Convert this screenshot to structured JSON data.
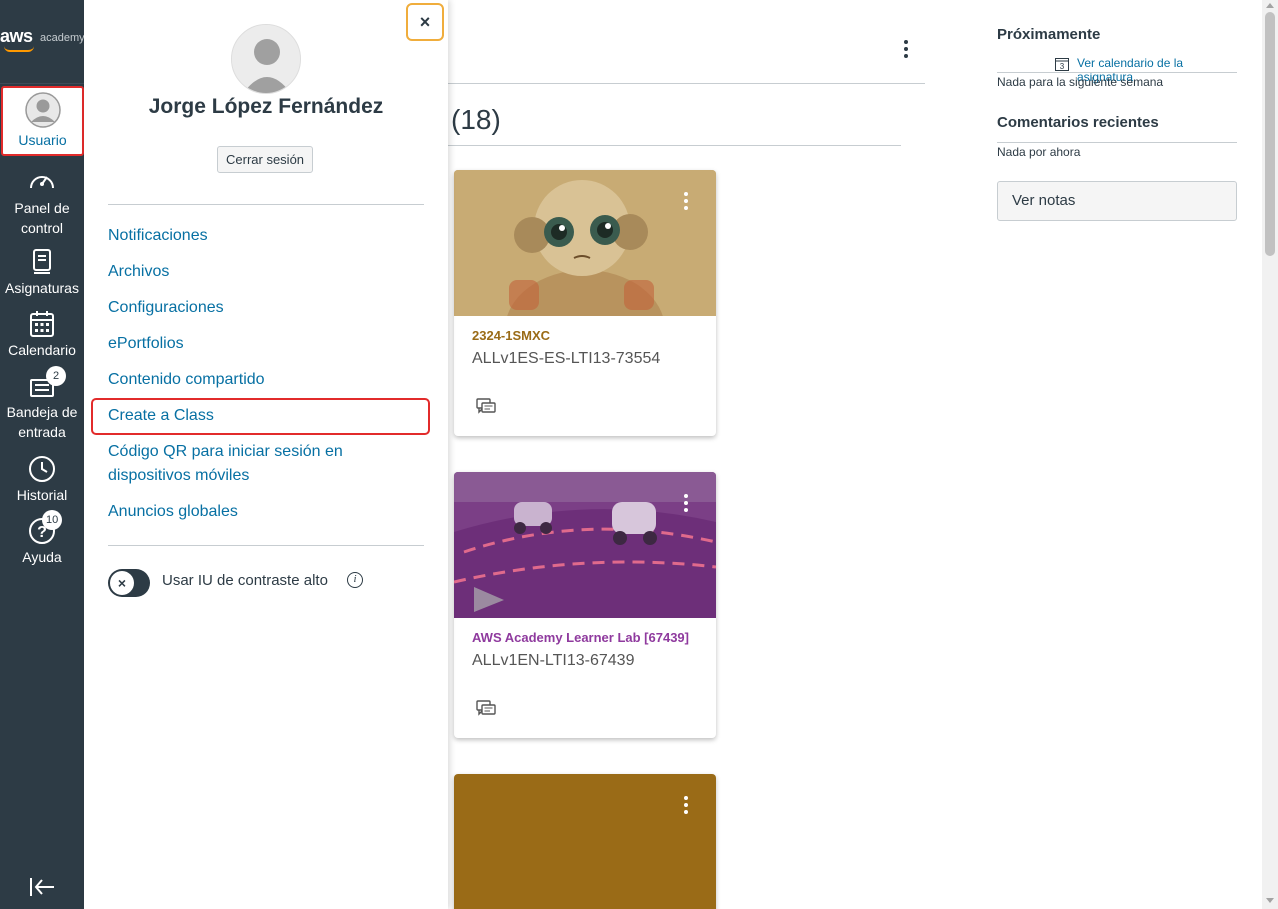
{
  "brand": {
    "aws": "aws",
    "academy": "academy"
  },
  "global_nav": {
    "items": [
      {
        "label": "Usuario",
        "active": true
      },
      {
        "label": "Panel de control"
      },
      {
        "label": "Asignaturas"
      },
      {
        "label": "Calendario"
      },
      {
        "label": "Bandeja de entrada",
        "badge": "2"
      },
      {
        "label": "Historial"
      },
      {
        "label": "Ayuda",
        "badge": "10"
      }
    ]
  },
  "dashboard": {
    "title_count": "(18)",
    "cards": [
      {
        "code": "2324-1SMXC",
        "term": "ALLv1ES-ES-LTI13-73554",
        "color": "#9a6b17"
      },
      {
        "code": "AWS Academy Learner Lab [67439]",
        "term": "ALLv1EN-LTI13-67439",
        "color": "#8f3a9e"
      },
      {
        "code": "",
        "term": "",
        "color": "#9a6b17"
      }
    ]
  },
  "right_sidebar": {
    "upcoming_heading": "Próximamente",
    "calendar_link": "Ver calendario de la asignatura",
    "calendar_day": "3",
    "upcoming_empty": "Nada para la siguiente semana",
    "feedback_heading": "Comentarios recientes",
    "feedback_empty": "Nada por ahora",
    "notes_button": "Ver notas"
  },
  "tray": {
    "close_label": "×",
    "user_name": "Jorge López Fernández",
    "logout": "Cerrar sesión",
    "links": [
      "Notificaciones",
      "Archivos",
      "Configuraciones",
      "ePortfolios",
      "Contenido compartido",
      "Create a Class",
      "Código QR para iniciar sesión en dispositivos móviles",
      "Anuncios globales"
    ],
    "contrast_label": "Usar IU de contraste alto",
    "toggle_state": "off",
    "info": "i"
  }
}
